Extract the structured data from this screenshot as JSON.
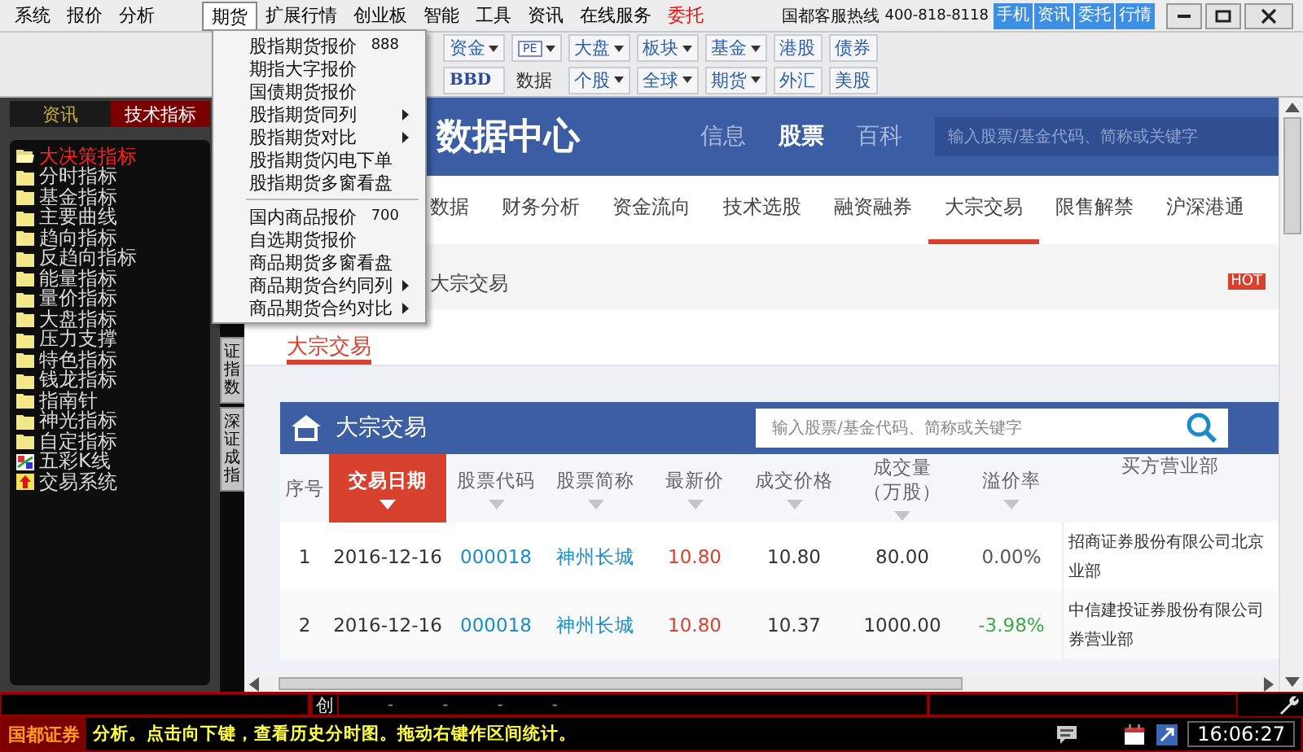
{
  "menu_bar": [
    {
      "label": "系统",
      "selected": false,
      "kind": "normal"
    },
    {
      "label": "报价",
      "selected": false,
      "kind": "normal"
    },
    {
      "label": "分析",
      "selected": false,
      "kind": "normal"
    },
    {
      "label": "期货",
      "selected": true,
      "kind": "normal"
    },
    {
      "label": "扩展行情",
      "selected": false,
      "kind": "normal"
    },
    {
      "label": "创业板",
      "selected": false,
      "kind": "normal"
    },
    {
      "label": "智能",
      "selected": false,
      "kind": "normal"
    },
    {
      "label": "工具",
      "selected": false,
      "kind": "normal"
    },
    {
      "label": "资讯",
      "selected": false,
      "kind": "normal"
    },
    {
      "label": "在线服务",
      "selected": false,
      "kind": "normal"
    },
    {
      "label": "委托",
      "selected": false,
      "kind": "alert"
    }
  ],
  "hotline": {
    "label": "国都客服热线",
    "number": "400-818-8118"
  },
  "quick_buttons": [
    "手机",
    "资讯",
    "委托",
    "行情"
  ],
  "toolbar": [
    {
      "top": {
        "label": "资金",
        "dropdown": true,
        "kind": "button"
      },
      "bottom": {
        "label": "BBD",
        "dropdown": false,
        "kind": "bold"
      }
    },
    {
      "top": {
        "label": "PE",
        "dropdown": true,
        "kind": "iconbox"
      },
      "bottom": {
        "label": "数据",
        "dropdown": false,
        "kind": "caption"
      }
    },
    {
      "top": {
        "label": "大盘",
        "dropdown": true,
        "kind": "button"
      },
      "bottom": {
        "label": "个股",
        "dropdown": true,
        "kind": "button"
      }
    },
    {
      "top": {
        "label": "板块",
        "dropdown": true,
        "kind": "button"
      },
      "bottom": {
        "label": "全球",
        "dropdown": true,
        "kind": "button"
      }
    },
    {
      "top": {
        "label": "基金",
        "dropdown": true,
        "kind": "button"
      },
      "bottom": {
        "label": "期货",
        "dropdown": true,
        "kind": "button"
      }
    },
    {
      "top": {
        "label": "港股",
        "dropdown": false,
        "kind": "button"
      },
      "bottom": {
        "label": "外汇",
        "dropdown": false,
        "kind": "button"
      }
    },
    {
      "top": {
        "label": "债券",
        "dropdown": false,
        "kind": "button"
      },
      "bottom": {
        "label": "美股",
        "dropdown": false,
        "kind": "button"
      }
    }
  ],
  "futures_menu": [
    [
      {
        "label": "股指期货报价",
        "shortcut": "888",
        "submenu": false
      },
      {
        "label": "期指大字报价",
        "submenu": false
      },
      {
        "label": "国债期货报价",
        "submenu": false
      },
      {
        "label": "股指期货同列",
        "submenu": true
      },
      {
        "label": "股指期货对比",
        "submenu": true
      },
      {
        "label": "股指期货闪电下单",
        "submenu": false
      },
      {
        "label": "股指期货多窗看盘",
        "submenu": false
      }
    ],
    [
      {
        "label": "国内商品报价",
        "shortcut": "700",
        "submenu": false
      },
      {
        "label": "自选期货报价",
        "submenu": false
      },
      {
        "label": "商品期货多窗看盘",
        "submenu": false
      },
      {
        "label": "商品期货合约同列",
        "submenu": true
      },
      {
        "label": "商品期货合约对比",
        "submenu": true
      }
    ]
  ],
  "left_panel": {
    "tabs": [
      {
        "label": "资讯",
        "selected": false
      },
      {
        "label": "技术指标",
        "selected": true
      }
    ],
    "items": [
      {
        "label": "大决策指标",
        "kind": "folder",
        "selected": true
      },
      {
        "label": "分时指标",
        "kind": "folder",
        "selected": false
      },
      {
        "label": "基金指标",
        "kind": "folder",
        "selected": false
      },
      {
        "label": "主要曲线",
        "kind": "folder",
        "selected": false
      },
      {
        "label": "趋向指标",
        "kind": "folder",
        "selected": false
      },
      {
        "label": "反趋向指标",
        "kind": "folder",
        "selected": false
      },
      {
        "label": "能量指标",
        "kind": "folder",
        "selected": false
      },
      {
        "label": "量价指标",
        "kind": "folder",
        "selected": false
      },
      {
        "label": "大盘指标",
        "kind": "folder",
        "selected": false
      },
      {
        "label": "压力支撑",
        "kind": "folder",
        "selected": false
      },
      {
        "label": "特色指标",
        "kind": "folder",
        "selected": false
      },
      {
        "label": "钱龙指标",
        "kind": "folder",
        "selected": false
      },
      {
        "label": "指南针",
        "kind": "folder",
        "selected": false
      },
      {
        "label": "神光指标",
        "kind": "folder",
        "selected": false
      },
      {
        "label": "自定指标",
        "kind": "folder",
        "selected": false
      },
      {
        "label": "五彩K线",
        "kind": "colorline",
        "selected": false
      },
      {
        "label": "交易系统",
        "kind": "system",
        "selected": false
      }
    ]
  },
  "vertical_tabs": [
    "证指数",
    "深证成指"
  ],
  "browser": {
    "header": {
      "title": "数据中心",
      "nav": [
        {
          "label": "信息",
          "selected": false
        },
        {
          "label": "股票",
          "selected": true
        },
        {
          "label": "百科",
          "selected": false
        }
      ],
      "search_placeholder": "输入股票/基金代码、简称或关键字"
    },
    "tabs": [
      {
        "label": "数据",
        "selected": false
      },
      {
        "label": "财务分析",
        "selected": false
      },
      {
        "label": "资金流向",
        "selected": false
      },
      {
        "label": "技术选股",
        "selected": false
      },
      {
        "label": "融资融券",
        "selected": false
      },
      {
        "label": "大宗交易",
        "selected": true
      },
      {
        "label": "限售解禁",
        "selected": false
      },
      {
        "label": "沪深港通",
        "selected": false
      }
    ],
    "breadcrumb": "大宗交易",
    "badge": "HOT",
    "subtab": {
      "label": "大宗交易",
      "selected": true
    },
    "panel": {
      "title": "大宗交易",
      "search_placeholder": "输入股票/基金代码、简称或关键字",
      "columns": [
        {
          "label": "序号",
          "sortable": false,
          "selected": false
        },
        {
          "label": "交易日期",
          "sortable": true,
          "selected": true
        },
        {
          "label": "股票代码",
          "sortable": true,
          "selected": false
        },
        {
          "label": "股票简称",
          "sortable": true,
          "selected": false
        },
        {
          "label": "最新价",
          "sortable": true,
          "selected": false
        },
        {
          "label": "成交价格",
          "sortable": true,
          "selected": false
        },
        {
          "label": "成交量（万股）",
          "sortable": true,
          "selected": false
        },
        {
          "label": "溢价率",
          "sortable": true,
          "selected": false
        },
        {
          "label": "买方营业部",
          "sortable": false,
          "selected": false
        }
      ],
      "rows": [
        {
          "index": "1",
          "date": "2016-12-16",
          "code": "000018",
          "name": "神州长城",
          "latest": "10.80",
          "price": "10.80",
          "volume": "80.00",
          "premium": "0.00%",
          "kind": "flat",
          "buyer_lines": [
            "招商证券股份有限公司北京",
            "业部"
          ]
        },
        {
          "index": "2",
          "date": "2016-12-16",
          "code": "000018",
          "name": "神州长城",
          "latest": "10.80",
          "price": "10.37",
          "volume": "1000.00",
          "premium": "-3.98%",
          "kind": "down",
          "buyer_lines": [
            "中信建投证券股份有限公司",
            "券营业部"
          ]
        }
      ]
    }
  },
  "status_bar": {
    "ticker": "创",
    "ticker_values": [
      "-",
      "-",
      "-",
      "-"
    ],
    "broker": "国都证券",
    "message": "分析。点击向下键，查看历史分时图。拖动右键作区间统计。",
    "time": "16:06:27"
  }
}
